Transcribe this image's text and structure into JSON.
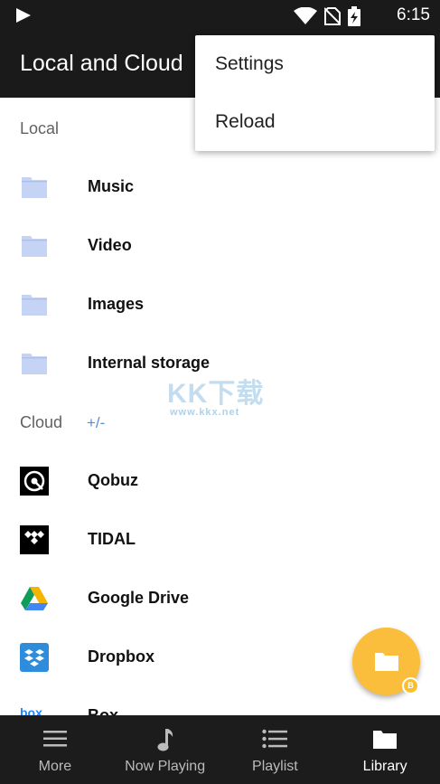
{
  "status_bar": {
    "time": "6:15",
    "icons": [
      "play-icon",
      "wifi-icon",
      "no-sim-icon",
      "battery-charging-icon"
    ]
  },
  "app_bar": {
    "title": "Local and Cloud"
  },
  "overflow_menu": {
    "items": [
      {
        "label": "Settings"
      },
      {
        "label": "Reload"
      }
    ]
  },
  "local": {
    "header": "Local",
    "items": [
      {
        "label": "Music",
        "icon": "folder-icon"
      },
      {
        "label": "Video",
        "icon": "folder-icon"
      },
      {
        "label": "Images",
        "icon": "folder-icon"
      },
      {
        "label": "Internal storage",
        "icon": "folder-icon"
      }
    ]
  },
  "cloud": {
    "header": "Cloud",
    "action": "+/-",
    "items": [
      {
        "label": "Qobuz",
        "icon": "qobuz-logo-icon"
      },
      {
        "label": "TIDAL",
        "icon": "tidal-logo-icon"
      },
      {
        "label": "Google Drive",
        "icon": "google-drive-logo-icon"
      },
      {
        "label": "Dropbox",
        "icon": "dropbox-logo-icon"
      },
      {
        "label": "Box",
        "icon": "box-logo-icon"
      }
    ]
  },
  "watermark": {
    "text": "KK下载",
    "url": "www.kkx.net"
  },
  "fab": {
    "icon": "folder-icon",
    "badge": "B"
  },
  "bottom_nav": {
    "items": [
      {
        "label": "More",
        "icon": "menu-icon"
      },
      {
        "label": "Now Playing",
        "icon": "music-note-icon"
      },
      {
        "label": "Playlist",
        "icon": "list-icon"
      },
      {
        "label": "Library",
        "icon": "folder-icon",
        "active": true
      }
    ]
  },
  "colors": {
    "bar": "#1a1a1a",
    "folder": "#c5d4f5",
    "accent": "#5b8bd6",
    "fab": "#fbbd3c"
  }
}
